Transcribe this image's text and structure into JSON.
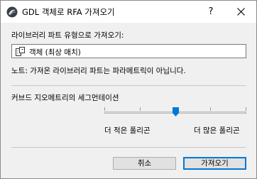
{
  "window": {
    "title": "GDL 객체로 RFA 가져오기",
    "help_label": "?",
    "close_label": "✕"
  },
  "part_type": {
    "label": "라이브러리 파트 유형으로 가져오기:",
    "selected": "객체 (최상 매치)",
    "icon": "library-object-icon"
  },
  "note": "노트: 가져온 라이브러리 파트는 파라메트릭이 아닙니다.",
  "curve": {
    "label": "커브드 지오메트리의 세그먼테이션",
    "fewer_label": "더 적은 폴리곤",
    "more_label": "더 많은 폴리곤",
    "level": 0.5
  },
  "buttons": {
    "cancel": "취소",
    "import": "가져오기"
  },
  "colors": {
    "accent": "#0078d7",
    "slider_thumb": "#0078d7"
  }
}
